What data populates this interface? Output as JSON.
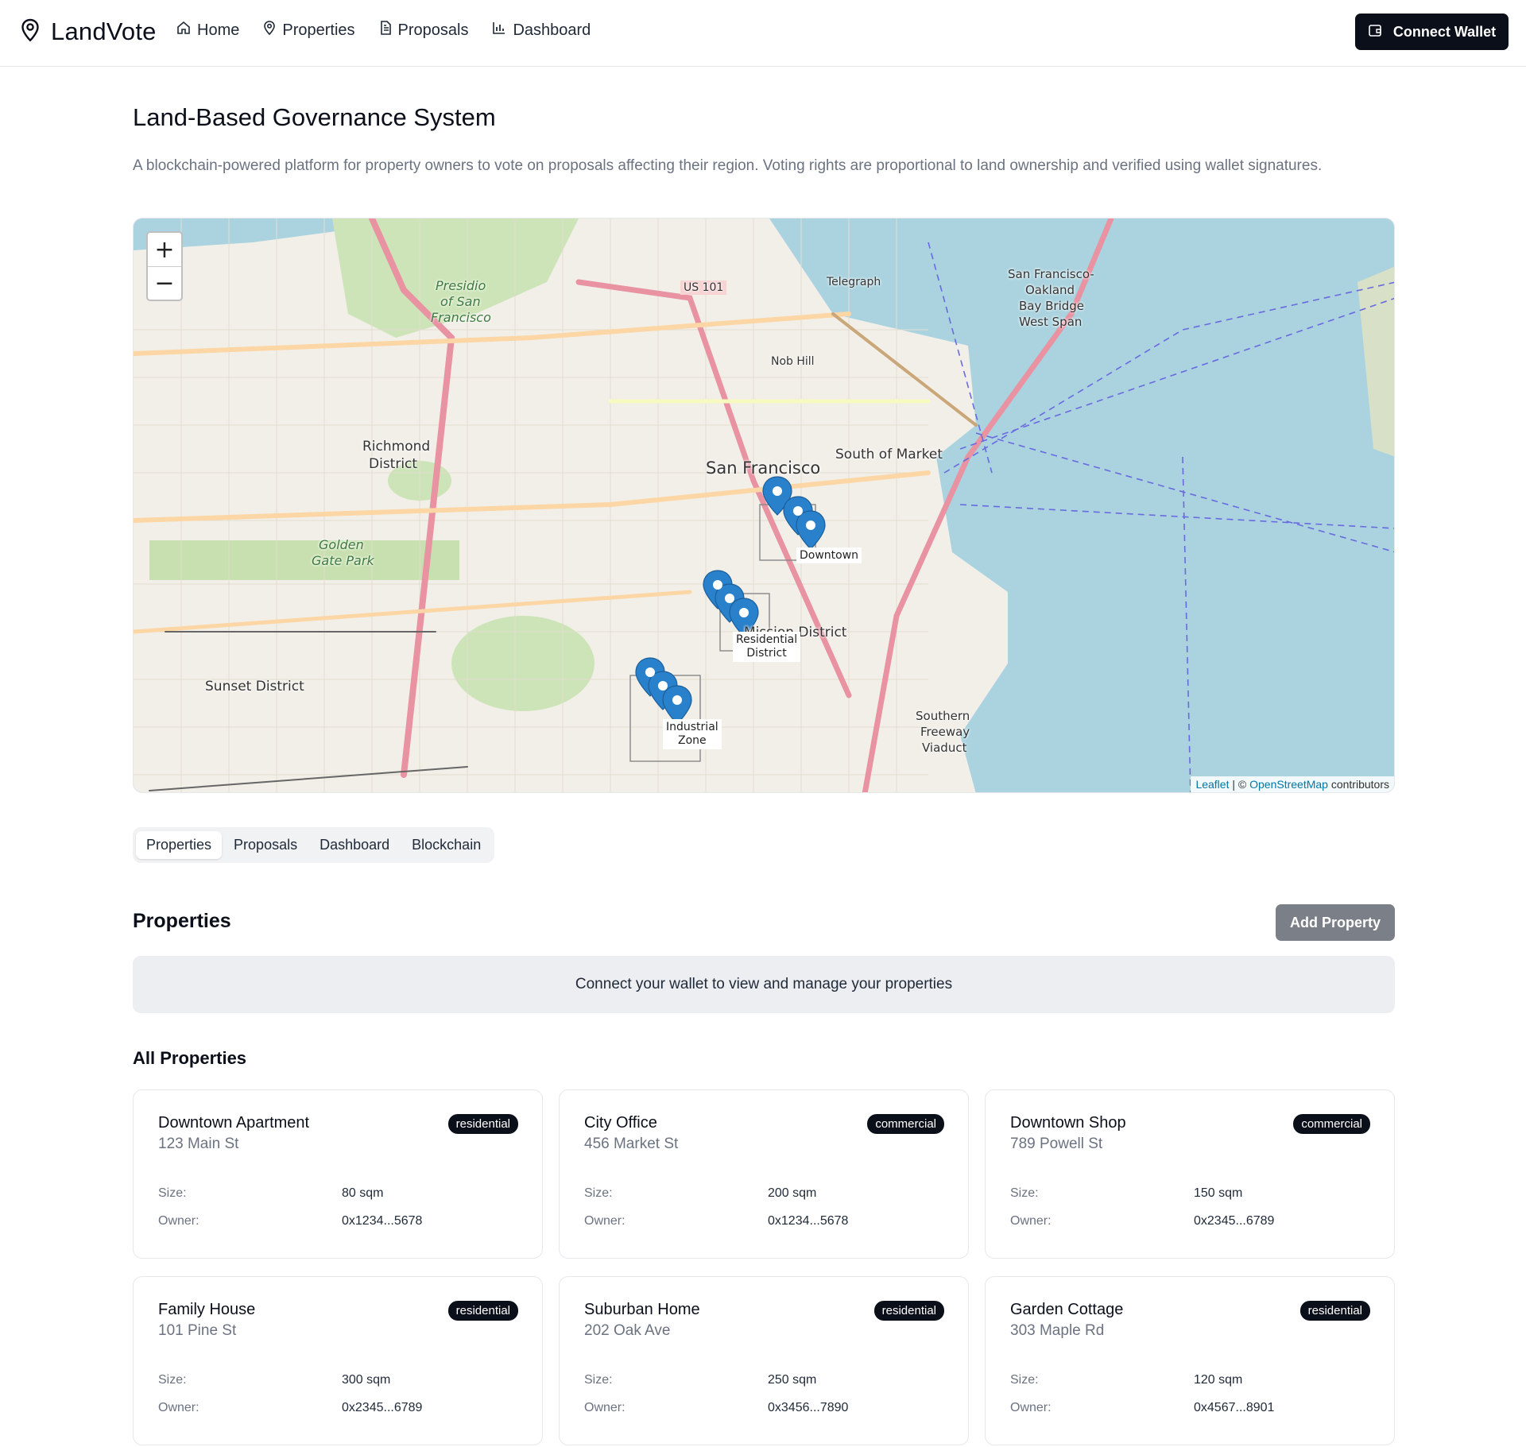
{
  "brand": {
    "name": "LandVote",
    "icon": "map-pin-icon"
  },
  "nav": [
    {
      "label": "Home",
      "icon": "home-icon"
    },
    {
      "label": "Properties",
      "icon": "map-pin-icon"
    },
    {
      "label": "Proposals",
      "icon": "document-icon"
    },
    {
      "label": "Dashboard",
      "icon": "bar-chart-icon"
    }
  ],
  "header": {
    "connect_label": "Connect Wallet",
    "connect_icon": "wallet-icon"
  },
  "main": {
    "title": "Land-Based Governance System",
    "description": "A blockchain-powered platform for property owners to vote on proposals affecting their region. Voting rights are proportional to land ownership and verified using wallet signatures."
  },
  "map": {
    "zoom_in": "+",
    "zoom_out": "−",
    "attribution": {
      "leaflet": "Leaflet",
      "sep": " | © ",
      "osm": "OpenStreetMap",
      "suffix": " contributors"
    },
    "labels": {
      "sf": "San Francisco",
      "richmond1": "Richmond",
      "richmond2": "District",
      "sunset": "Sunset District",
      "som": "South of Market",
      "bay1": "San Francisco-",
      "bay2": "Oakland",
      "bay3": "Bay Bridge",
      "bay4": "West Span",
      "presidio1": "Presidio",
      "presidio2": "of San",
      "presidio3": "Francisco",
      "golden1": "Golden",
      "golden2": "Gate Park",
      "telegraph": "Telegraph",
      "nob": "Nob Hill",
      "mission": "Mission District",
      "us101": "US 101",
      "southern1": "Southern",
      "southern2": "Freeway",
      "southern3": "Viaduct"
    },
    "zones": {
      "downtown": "Downtown",
      "residential1": "Residential",
      "residential2": "District",
      "industrial1": "Industrial",
      "industrial2": "Zone"
    }
  },
  "tabs": [
    "Properties",
    "Proposals",
    "Dashboard",
    "Blockchain"
  ],
  "properties_section": {
    "title": "Properties",
    "add_label": "Add Property",
    "notice": "Connect your wallet to view and manage your properties",
    "all_title": "All Properties",
    "size_label": "Size:",
    "owner_label": "Owner:"
  },
  "cards": [
    {
      "name": "Downtown Apartment",
      "address": "123 Main St",
      "type": "residential",
      "size": "80 sqm",
      "owner": "0x1234...5678"
    },
    {
      "name": "City Office",
      "address": "456 Market St",
      "type": "commercial",
      "size": "200 sqm",
      "owner": "0x1234...5678"
    },
    {
      "name": "Downtown Shop",
      "address": "789 Powell St",
      "type": "commercial",
      "size": "150 sqm",
      "owner": "0x2345...6789"
    },
    {
      "name": "Family House",
      "address": "101 Pine St",
      "type": "residential",
      "size": "300 sqm",
      "owner": "0x2345...6789"
    },
    {
      "name": "Suburban Home",
      "address": "202 Oak Ave",
      "type": "residential",
      "size": "250 sqm",
      "owner": "0x3456...7890"
    },
    {
      "name": "Garden Cottage",
      "address": "303 Maple Rd",
      "type": "residential",
      "size": "120 sqm",
      "owner": "0x4567...8901"
    }
  ],
  "colors": {
    "primary": "#0b0f19",
    "muted": "#6b7280",
    "water": "#aad3df",
    "marker": "#2a81cb"
  }
}
